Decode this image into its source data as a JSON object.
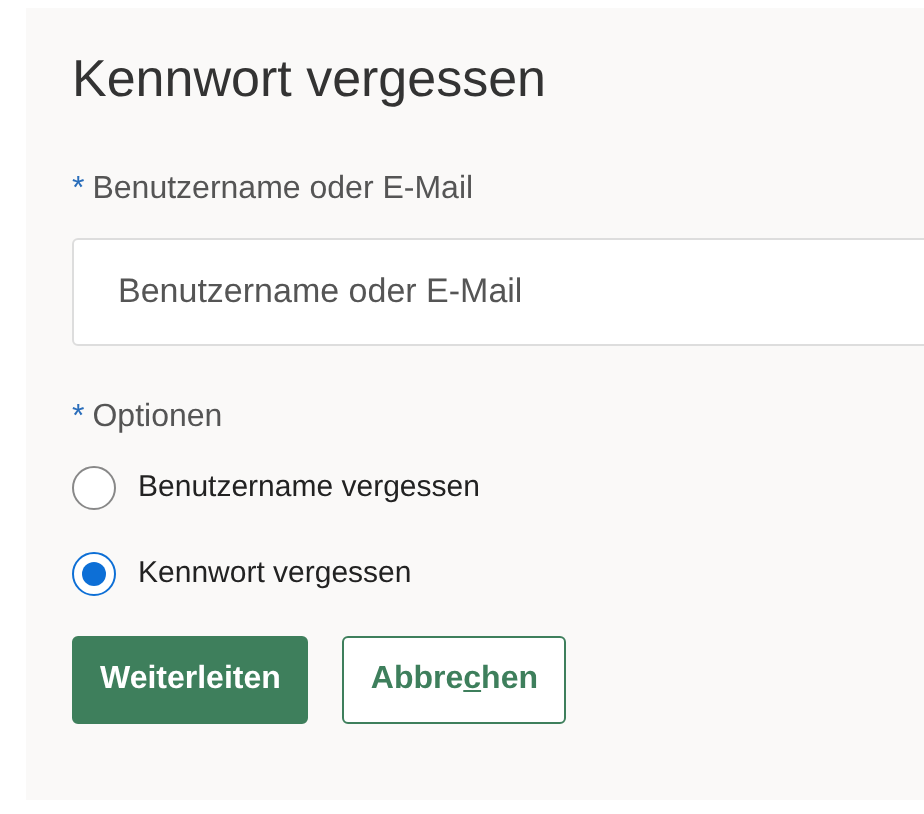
{
  "title": "Kennwort vergessen",
  "username_field": {
    "label": "Benutzername oder E-Mail",
    "required_mark": "*",
    "placeholder": "Benutzername oder E-Mail"
  },
  "options": {
    "label": "Optionen",
    "required_mark": "*",
    "choices": [
      {
        "label": "Benutzername vergessen",
        "selected": false
      },
      {
        "label": "Kennwort vergessen",
        "selected": true
      }
    ]
  },
  "buttons": [
    {
      "kind": "primary",
      "label": "Weiterleiten"
    },
    {
      "kind": "secondary",
      "label_before": "Abbre",
      "access_key": "c",
      "label_after": "hen"
    }
  ]
}
